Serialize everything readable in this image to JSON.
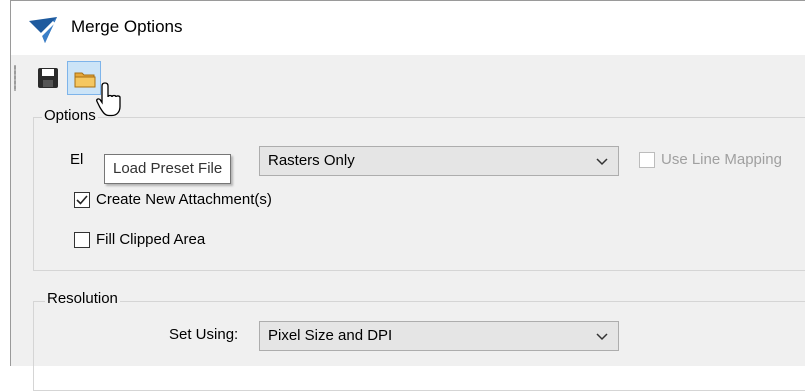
{
  "window": {
    "title": "Merge Options"
  },
  "toolbar": {
    "save_icon": "floppy-disk-icon",
    "open_icon": "folder-open-icon",
    "tooltip": "Load Preset File"
  },
  "options_group": {
    "label": "Options",
    "element_label_visible": "El",
    "element_combo": {
      "value": "Rasters Only"
    },
    "use_line_mapping": {
      "label": "Use Line Mapping",
      "checked": false,
      "enabled": false
    },
    "create_new_attachments": {
      "label": "Create New Attachment(s)",
      "checked": true
    },
    "fill_clipped_area": {
      "label": "Fill Clipped Area",
      "checked": false
    }
  },
  "resolution_group": {
    "label": "Resolution",
    "set_using_label": "Set Using:",
    "set_using_combo": {
      "value": "Pixel Size and DPI"
    }
  },
  "colors": {
    "background": "#f0f0f0",
    "titlebar": "#ffffff",
    "accent_blue": "#1e5a9e",
    "hover_blue": "#cce4f7"
  }
}
